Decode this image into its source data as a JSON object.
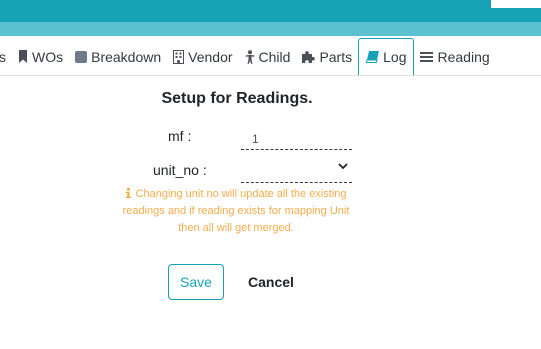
{
  "colors": {
    "accent": "#17a2b8",
    "warning": "#f0ad4e"
  },
  "tabs": [
    {
      "label": "s",
      "icon": ""
    },
    {
      "label": "WOs",
      "icon": "bookmark-icon"
    },
    {
      "label": "Breakdown",
      "icon": "square-icon"
    },
    {
      "label": "Vendor",
      "icon": "building-icon"
    },
    {
      "label": "Child",
      "icon": "child-icon"
    },
    {
      "label": "Parts",
      "icon": "puzzle-icon"
    },
    {
      "label": "Log",
      "icon": "book-icon",
      "active": true
    },
    {
      "label": "Reading",
      "icon": "list-icon"
    }
  ],
  "form": {
    "title": "Setup for Readings.",
    "mf_label": "mf :",
    "mf_value": "1",
    "unit_label": "unit_no :",
    "unit_value": "",
    "warning_icon": "info-icon",
    "warning_text": "Changing unit no will update all the existing readings and if reading exists for mapping Unit then all will get merged."
  },
  "actions": {
    "save_label": "Save",
    "cancel_label": "Cancel"
  }
}
